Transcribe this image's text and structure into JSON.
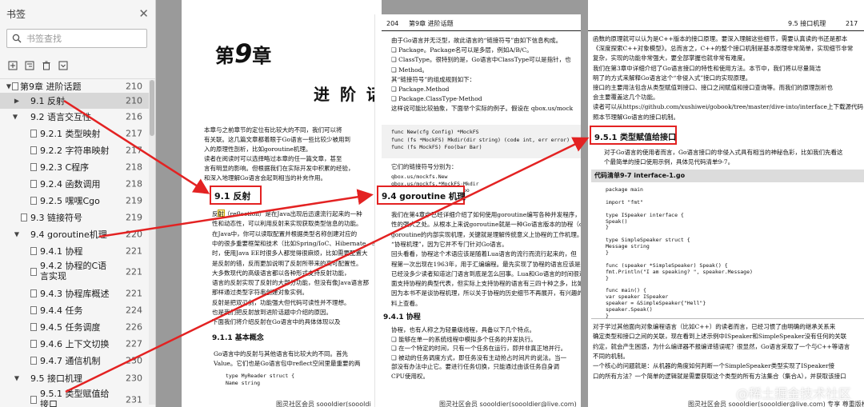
{
  "sidebar": {
    "title": "书签",
    "search_placeholder": "书签查找",
    "items": [
      {
        "label": "第9章 进阶话题",
        "page": "210"
      },
      {
        "label": "9.1   反射",
        "page": "210"
      },
      {
        "label": "9.2   语言交互性",
        "page": "216"
      },
      {
        "label": "9.2.1  类型映射",
        "page": "217"
      },
      {
        "label": "9.2.2  字符串映射",
        "page": "217"
      },
      {
        "label": "9.2.3  C程序",
        "page": "218"
      },
      {
        "label": "9.2.4  函数调用",
        "page": "218"
      },
      {
        "label": "9.2.5  嘿嘿Cgo",
        "page": "219"
      },
      {
        "label": "9.3   链接符号",
        "page": "219"
      },
      {
        "label": "9.4   goroutine机理",
        "page": "220"
      },
      {
        "label": "9.4.1  协程",
        "page": "221"
      },
      {
        "label": "9.4.2  协程的C语言实现",
        "page": "221"
      },
      {
        "label": "9.4.3  协程库概述",
        "page": "221"
      },
      {
        "label": "9.4.4  任务",
        "page": "224"
      },
      {
        "label": "9.4.5  任务调度",
        "page": "226"
      },
      {
        "label": "9.4.6  上下文切换",
        "page": "227"
      },
      {
        "label": "9.4.7  通信机制",
        "page": "230"
      },
      {
        "label": "9.5   接口机理",
        "page": "230"
      },
      {
        "label": "9.5.1  类型赋值给接口",
        "page": "231"
      }
    ]
  },
  "page1": {
    "chapter_prefix": "第",
    "chapter_num": "9",
    "chapter_suffix": "章",
    "chapter_title": "进 阶 话 是",
    "intro": [
      "本章与之前章节的定位有比较大的不同，我们可以将",
      "有关联。这几篇文章都着眼于Go语言一些比较少被用到",
      "入的原理性剖析，比如goroutine机理。",
      "读者在阅读时可以选择略过本章的任一篇文章，甚至",
      "言有明显的影响。但根据我们在实际开发中积累的经验，",
      "和深入地理解Go语言会起到相当的补充作用。"
    ],
    "sec_9_1": "9.1   反射",
    "reflect": [
      "反射（reflection）是在Java出现后迅速流行起来的一种",
      "性和动态性，可以利用反射来实现获取类型信息的功能。",
      "在Java中，你可以读取配置并根据类型名称创建对应的",
      "中的很多重要框架和技术（比如Spring/IoC、Hibernate、S",
      "时，使用Java EE时很多人都觉得很麻烦，比如需要配置大",
      "是反射的错，反而更加说明了反射所带来的高可配置性。",
      "大多数现代的高级语言都以各种形式支持反射功能，",
      "语言的反射实现了反射的大部分功能，但没有像Java语言那",
      "那样通过类型字符串创建对象实例。",
      "反射是把双刃剑，功能强大但代码可读性并不理想。",
      "也是我们把反射放到进阶话题中介绍的原因。",
      "下面我们将介绍反射在Go语言中的具体体现以及"
    ],
    "sec_9_1_1": "9.1.1   基本概念",
    "basic": [
      "Go语言中的反射与其他语言有比较大的不同。首先",
      "Value。它们也是Go语言包中reflect空间里最重要的两"
    ],
    "code": [
      "type MyReader struct {",
      "    Name string"
    ],
    "footer": "图灵社区会员 soooldier(soooldi"
  },
  "page2": {
    "page_number": "204",
    "chapter_header": "第9章   进阶话题",
    "lines": [
      "由于Go语言并无泛型，故此语言的“链接符号”由如下信息构成。",
      "❑ Package。Package名可以是多层，例如A/B/C。",
      "❑ ClassType。很特别的是，Go语言中ClassType可以是指针，也",
      "❑ Method。",
      "其“链接符号”的组成规则如下：",
      "❑ Package.Method",
      "❑ Package.ClassType·Method",
      "这样说可能比较抽象，下面举个实际的例子。假设在 qbox.us/mock"
    ],
    "code": [
      "func New(cfg Config) *MockFS",
      "func (fs *MockFS) Mkdir(dir string) (code int, err error)",
      "func (fs MockFS) Foo(bar Bar)"
    ],
    "mid": "它们的链接符号分别为：",
    "syms": [
      "qbox.us/mockfs.New",
      "qbox.us/mockfs.*MockFS·Mkdir",
      "qbox.us/mockfs.MockFS·Foo"
    ],
    "sec_9_4": "9.4   goroutine 机理",
    "body": [
      "我们在第4章中已经详细介绍了如何使用goroutine编写各种并发程序，",
      "性的强大之处。从根本上来说goroutine就是一种Go语言版本的协程（coro",
      "goroutine的内部实现机理，关键就是理解传统意义上协程的工作机理。此处，我",
      "“协程机理”，因为它并不专门针对Go语言。",
      "回头看看，协程这个术语应该是随着Lua语言的流行而流行起来的，但",
      "程第一次出现在1963年，用于汇编编程。最先实现了协程的语言应该是Simu",
      "已经没多少读者知道这门语言到底是怎么回事。Lua和Go语言的时间很近",
      "面支持协程的典型代表，但实际上支持协程的语言有三四十种之多，比如Py",
      "因为本书不是谈协程机理，所以关于协程的历史细节不再展开，有兴趣的读者",
      "料上查看。"
    ],
    "sec_9_4_1": "9.4.1   协程",
    "sub": [
      "协程，也有人称之为轻量级线程，具备以下几个特点。",
      "❑ 能够在单一的系统线程中模拟多个任务的并发执行。",
      "❑ 在一个特定的时间，只有一个任务在运行，即并非真正地并行。",
      "❑ 被动的任务调度方式，即任务没有主动抢占时间片的说法。当一",
      "   部没有办法中止它。要进行任务切换，只能通过由该任务自身调",
      "   CPU使用权。"
    ],
    "footer": "图灵社区会员 soooldier(soooldier@live.com)"
  },
  "page3": {
    "header_right": "9.5   接口机理",
    "page_number": "217",
    "intro": [
      "函数的原理就可以认为是C++版本的接口原理。要深入理解这些细节，需要认真读的书还是那本",
      "《深度探索C++对象模型》。总而言之，C++的整个接口机制是基本原理非常简单，实现细节非常",
      "复杂，实现的功能非常强大，要全部掌握也就非常有难度。",
      "我们在第3章中详细介绍了Go语言接口的特性和使用方法。本节中，我们将以尽量简洁",
      "明了的方式来解释Go语言这个“非侵入式”接口的实现原理。",
      "接口的主要用法包含从类型赋值到接口、接口之间赋值和接口查询等。而我们的原理剖析也",
      "会主要覆盖这几个功能。",
      "读者可以从https://github.com/xushiwei/gobook/tree/master/dive-into/interface上下载源代码，对",
      "照本节理解Go语言的接口机制。"
    ],
    "sec_9_5_1": "9.5.1   类型赋值给接口",
    "para": [
      "对于Go语言的使用者而言，Go语言接口的非侵入式具有相当的神秘色彩，比如我们先看这",
      "个最简单的接口使用示例，具体见代码清单9-7。"
    ],
    "listing": "代码清单9-7   interface-1.go",
    "code": [
      "package main",
      "",
      "import \"fmt\"",
      "",
      "type ISpeaker interface {",
      "    Speak()",
      "}",
      "",
      "type SimpleSpeaker struct {",
      "    Message string",
      "}",
      "",
      "func (speaker *SimpleSpeaker) Speak() {",
      "    fmt.Println(\"I am speaking? \", speaker.Message)",
      "}",
      "",
      "func main() {",
      "var speaker ISpeaker",
      "    speaker = &SimpleSpeaker{\"Hell\"}",
      "    speaker.Speak()",
      "}"
    ],
    "after": [
      "对于学过其他面向对象编程语言（比如C++）的读者而言，已经习惯了由明确的继承关系来",
      "确定类型和接口之间的关联，现在看到上述示例中ISpeaker和SimpleSpeaker没有任何的关联",
      "约定，就会产生困惑，为什么编译器不报编译错误呢？很显然，Go语言采取了一个与C++等语言",
      "不同的机制。",
      "一个核心的问题就是：从机器的角度如何判断一个SimpleSpeaker类型实现了ISpeaker接",
      "口的所有方法？一个简单的逻辑就是需要获取这个类型的所有方法集合（集合A），并获取该接口"
    ],
    "footer": "图灵社区会员 soooldier(soooldier@live.com) 专享 尊重版权"
  },
  "watermark": "@稀土掘金技术社区",
  "colors": {
    "annotation": "#e32222"
  }
}
